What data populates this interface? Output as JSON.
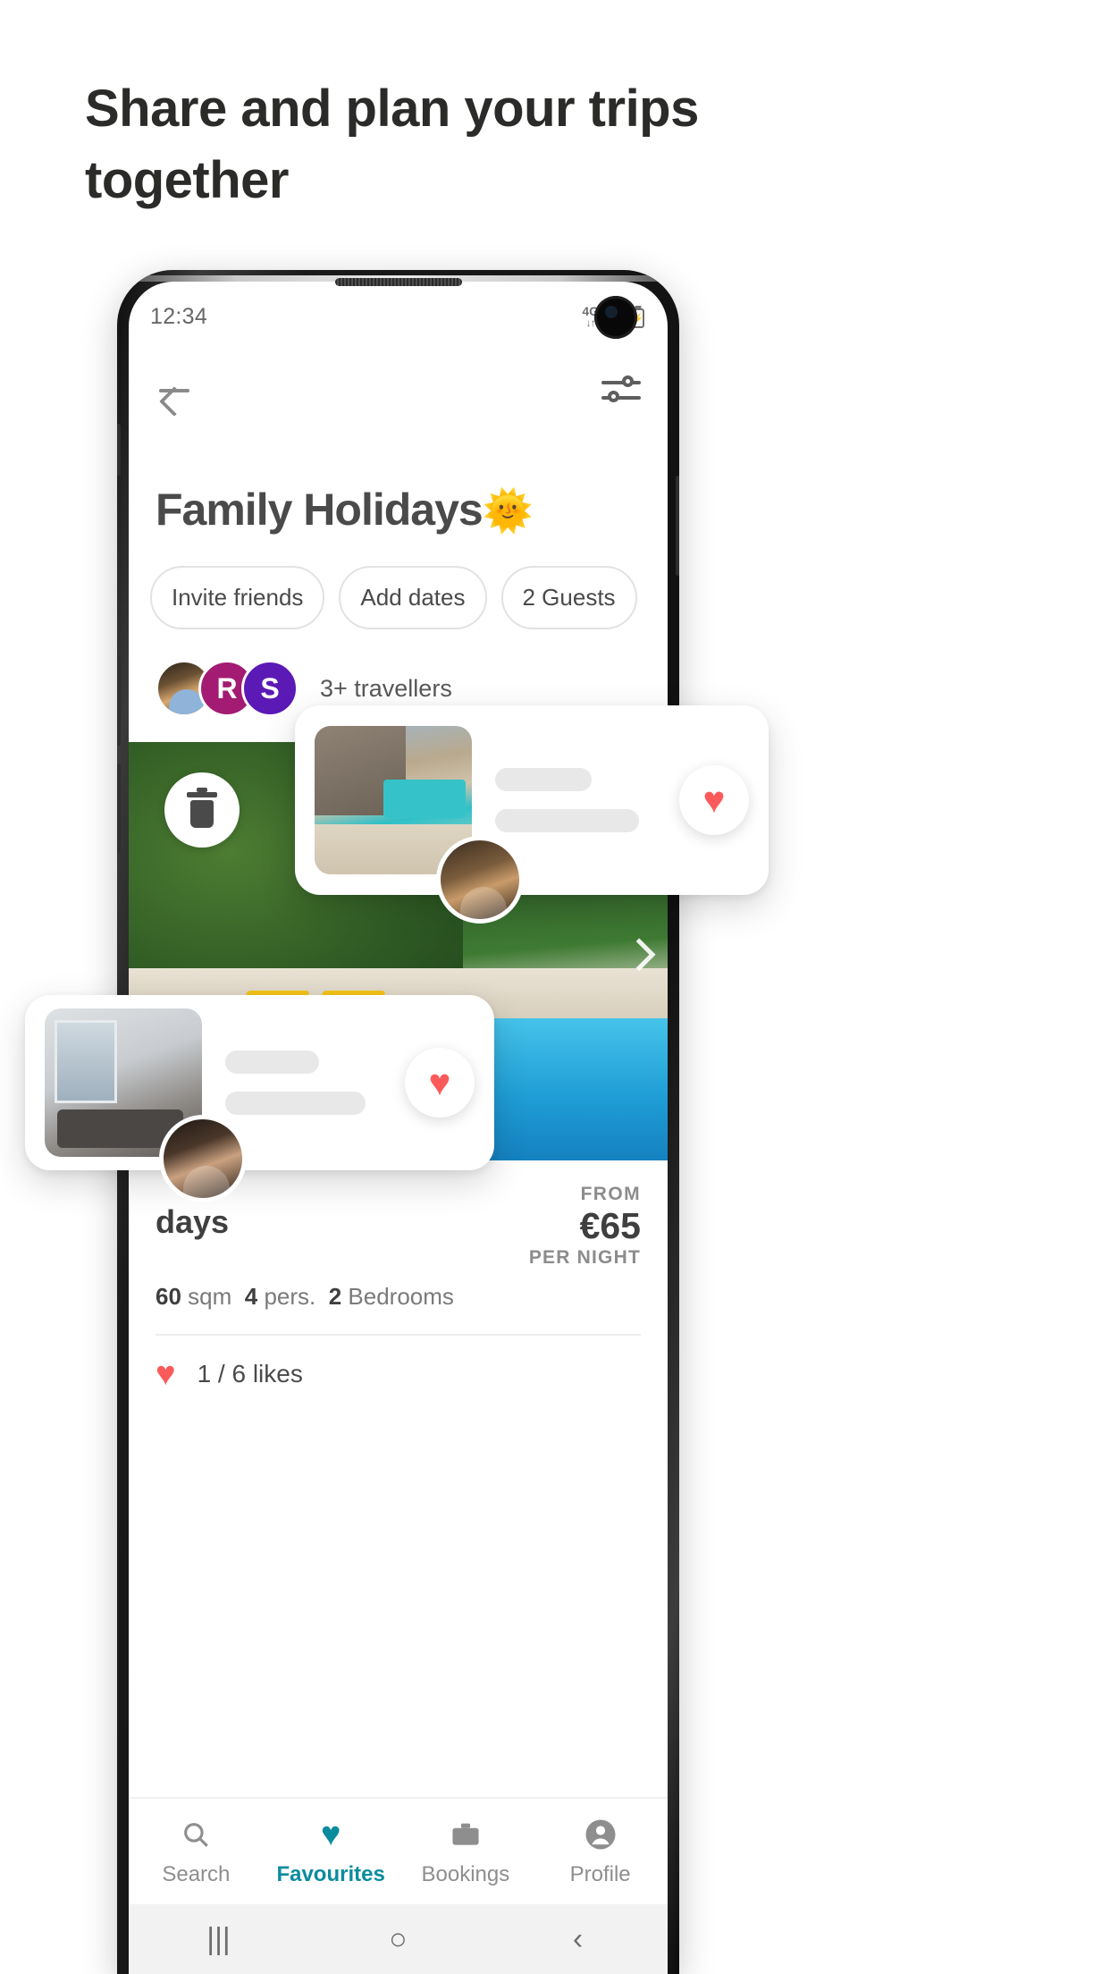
{
  "headline": "Share and plan your trips together",
  "phone": {
    "statusbar": {
      "clock": "12:34",
      "network_label": "4G",
      "network_arrows": "↓↑",
      "battery_glyph": "⚡"
    },
    "appbar": {
      "back_icon": "back-arrow-icon",
      "filter_icon": "filter-sliders-icon"
    },
    "trip": {
      "title": "Family Holidays",
      "title_emoji": "🌞",
      "pills": [
        {
          "label": "Invite friends"
        },
        {
          "label": "Add dates"
        },
        {
          "label": "2 Guests"
        }
      ],
      "travellers": {
        "avatars": [
          {
            "type": "photo",
            "initial": ""
          },
          {
            "type": "initial",
            "initial": "R",
            "color": "#a31b72"
          },
          {
            "type": "initial",
            "initial": "S",
            "color": "#5b19b5"
          }
        ],
        "count_label": "3+ travellers"
      },
      "property": {
        "name": "days",
        "price_from_label": "FROM",
        "price_value": "€65",
        "price_per_label": "PER NIGHT",
        "spec_size_value": "60",
        "spec_size_unit": "sqm",
        "spec_pers_value": "4",
        "spec_pers_unit": "pers.",
        "spec_bedrooms_value": "2",
        "spec_bedrooms_unit": "Bedrooms",
        "likes_text": "1 / 6 likes",
        "delete_icon": "trash-icon",
        "next_icon": "chevron-right-icon"
      }
    },
    "bottomnav": {
      "items": [
        {
          "label": "Search",
          "icon": "search-icon",
          "glyph": "⌕",
          "active": false
        },
        {
          "label": "Favourites",
          "icon": "heart-icon",
          "glyph": "♥",
          "active": true
        },
        {
          "label": "Bookings",
          "icon": "briefcase-icon",
          "glyph": "▬",
          "active": false
        },
        {
          "label": "Profile",
          "icon": "person-icon",
          "glyph": "●",
          "active": false
        }
      ],
      "active_color": "#0b8c9e"
    },
    "androidnav": {
      "recents": "|||",
      "home": "○",
      "back": "‹"
    }
  },
  "floating_cards": [
    {
      "id": "top",
      "thumbnail": "villa-pool-thumbnail",
      "heart_icon": "heart-icon",
      "heart_color": "#fb5a5a",
      "avatar": "user-avatar"
    },
    {
      "id": "bottom",
      "thumbnail": "interior-living-room-thumbnail",
      "heart_icon": "heart-icon",
      "heart_color": "#fb5a5a",
      "avatar": "user-avatar"
    }
  ]
}
